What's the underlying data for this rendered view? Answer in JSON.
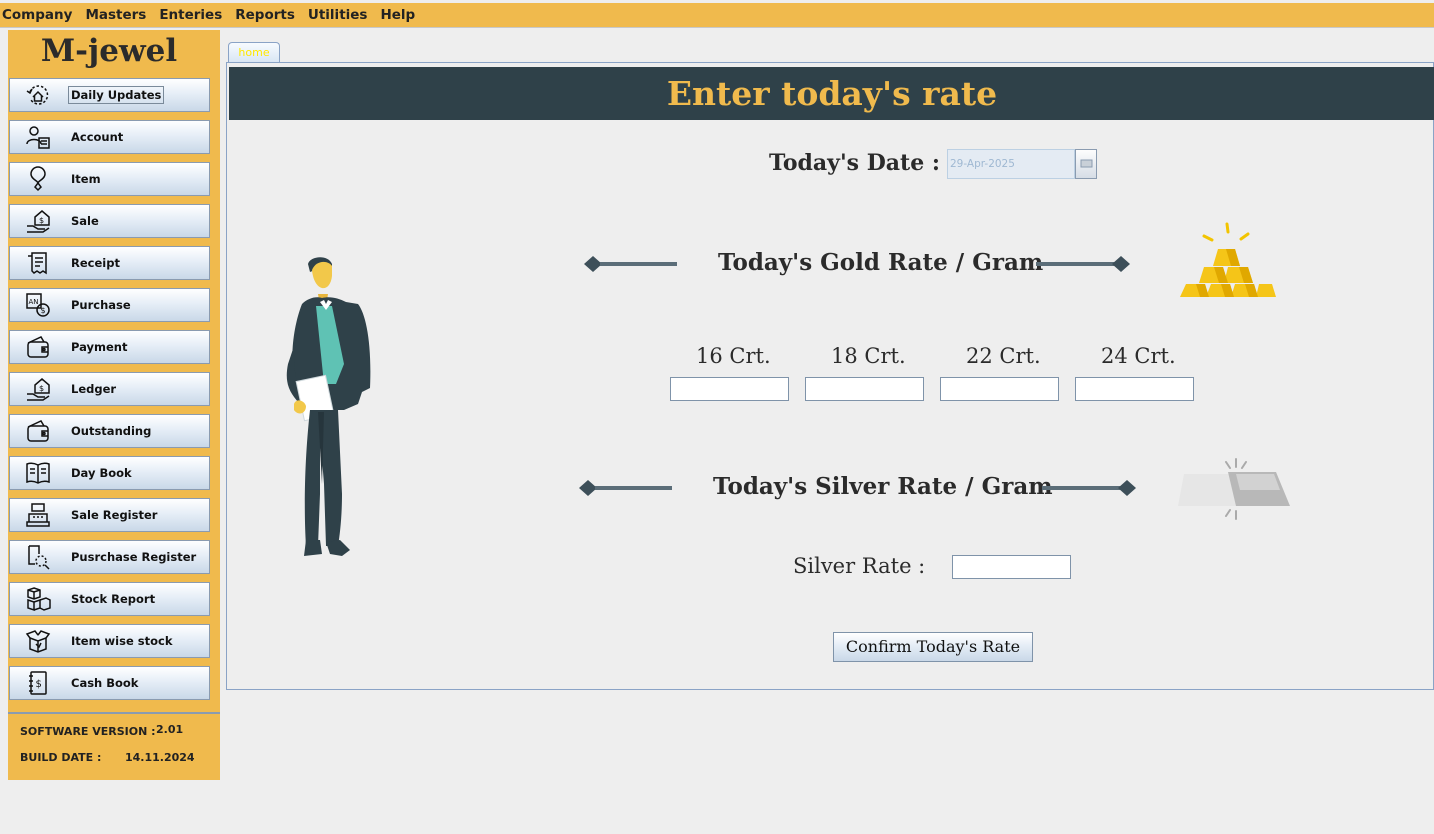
{
  "menu": [
    "Company",
    "Masters",
    "Enteries",
    "Reports",
    "Utilities",
    "Help"
  ],
  "sidebar": {
    "logo": "M-jewel",
    "items": [
      {
        "label": "Daily Updates",
        "icon": "update-icon"
      },
      {
        "label": "Account",
        "icon": "account-icon"
      },
      {
        "label": "Item",
        "icon": "item-icon"
      },
      {
        "label": "Sale",
        "icon": "sale-icon"
      },
      {
        "label": "Receipt",
        "icon": "receipt-icon"
      },
      {
        "label": "Purchase",
        "icon": "purchase-icon"
      },
      {
        "label": "Payment",
        "icon": "wallet-icon"
      },
      {
        "label": "Ledger",
        "icon": "ledger-icon"
      },
      {
        "label": "Outstanding",
        "icon": "wallet-icon"
      },
      {
        "label": "Day Book",
        "icon": "book-icon"
      },
      {
        "label": "Sale Register",
        "icon": "register-icon"
      },
      {
        "label": "Pusrchase Register",
        "icon": "purchase-register-icon"
      },
      {
        "label": "Stock Report",
        "icon": "boxes-icon"
      },
      {
        "label": "Item wise stock",
        "icon": "open-box-icon"
      },
      {
        "label": "Cash Book",
        "icon": "cash-book-icon"
      }
    ],
    "version_label": "SOFTWARE VERSION :",
    "version_value": "2.01",
    "build_label": "BUILD DATE :",
    "build_value": "14.11.2024"
  },
  "tab": {
    "label": "home"
  },
  "main": {
    "header": "Enter today's rate",
    "date_label": "Today's Date :",
    "date_value": "29-Apr-2025",
    "gold_title": "Today's Gold Rate / Gram",
    "carats": [
      "16 Crt.",
      "18 Crt.",
      "22 Crt.",
      "24 Crt."
    ],
    "carat_values": [
      "",
      "",
      "",
      ""
    ],
    "silver_title": "Today's Silver Rate / Gram",
    "silver_label": "Silver Rate :",
    "silver_value": "",
    "confirm_label": "Confirm Today's Rate"
  },
  "colors": {
    "accent": "#f0ba4d",
    "header_bg": "#2f4149",
    "background": "#eeeeee"
  }
}
